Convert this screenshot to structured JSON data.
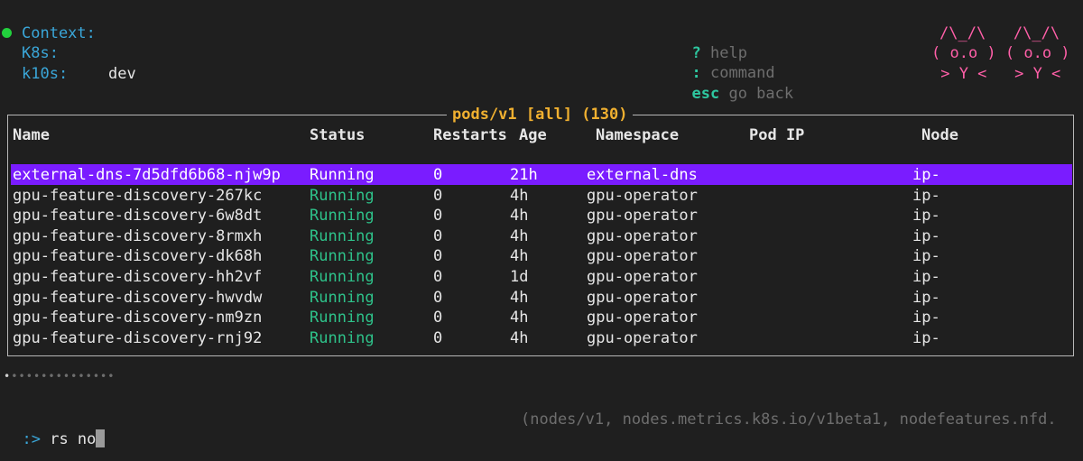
{
  "context": {
    "context_label": "Context:",
    "k8s_label": "K8s:",
    "k10s_label": "k10s:",
    "k10s_value": "dev",
    "status_color": "#22d13d"
  },
  "help": [
    {
      "key": "?",
      "desc": "help"
    },
    {
      "key": ":",
      "desc": "command"
    },
    {
      "key": "esc",
      "desc": "go back"
    }
  ],
  "logo": {
    "line1": "/\\_/\\   /\\_/\\",
    "line2": "( o.o ) ( o.o )",
    "line3": " > Y <   > Y <"
  },
  "table": {
    "title": "pods/v1 [all] (130)",
    "columns": {
      "name": "Name",
      "status": "Status",
      "restarts": "Restarts",
      "age": "Age",
      "namespace": "Namespace",
      "pod_ip": "Pod IP",
      "node": "Node"
    },
    "rows": [
      {
        "name": "external-dns-7d5dfd6b68-njw9p",
        "status": "Running",
        "restarts": "0",
        "age": "21h",
        "namespace": "external-dns",
        "pod_ip": "",
        "node": "ip-"
      },
      {
        "name": "gpu-feature-discovery-267kc",
        "status": "Running",
        "restarts": "0",
        "age": "4h",
        "namespace": "gpu-operator",
        "pod_ip": "",
        "node": "ip-"
      },
      {
        "name": "gpu-feature-discovery-6w8dt",
        "status": "Running",
        "restarts": "0",
        "age": "4h",
        "namespace": "gpu-operator",
        "pod_ip": "",
        "node": "ip-"
      },
      {
        "name": "gpu-feature-discovery-8rmxh",
        "status": "Running",
        "restarts": "0",
        "age": "4h",
        "namespace": "gpu-operator",
        "pod_ip": "",
        "node": "ip-"
      },
      {
        "name": "gpu-feature-discovery-dk68h",
        "status": "Running",
        "restarts": "0",
        "age": "4h",
        "namespace": "gpu-operator",
        "pod_ip": "",
        "node": "ip-"
      },
      {
        "name": "gpu-feature-discovery-hh2vf",
        "status": "Running",
        "restarts": "0",
        "age": "1d",
        "namespace": "gpu-operator",
        "pod_ip": "",
        "node": "ip-"
      },
      {
        "name": "gpu-feature-discovery-hwvdw",
        "status": "Running",
        "restarts": "0",
        "age": "4h",
        "namespace": "gpu-operator",
        "pod_ip": "",
        "node": "ip-"
      },
      {
        "name": "gpu-feature-discovery-nm9zn",
        "status": "Running",
        "restarts": "0",
        "age": "4h",
        "namespace": "gpu-operator",
        "pod_ip": "",
        "node": "ip-"
      },
      {
        "name": "gpu-feature-discovery-rnj92",
        "status": "Running",
        "restarts": "0",
        "age": "4h",
        "namespace": "gpu-operator",
        "pod_ip": "",
        "node": "ip-"
      }
    ],
    "selected_index": 0
  },
  "pager": {
    "total_dots": 15,
    "active_index": 0
  },
  "command": {
    "prompt": ":>",
    "value": "rs no",
    "suggestion": "(nodes/v1, nodes.metrics.k8s.io/v1beta1, nodefeatures.nfd."
  },
  "colors": {
    "highlight": "#7a1cff",
    "running": "#2ec28a",
    "title": "#f0b030",
    "accent_blue": "#3aa6d8",
    "logo_pink": "#ff5fa8"
  }
}
